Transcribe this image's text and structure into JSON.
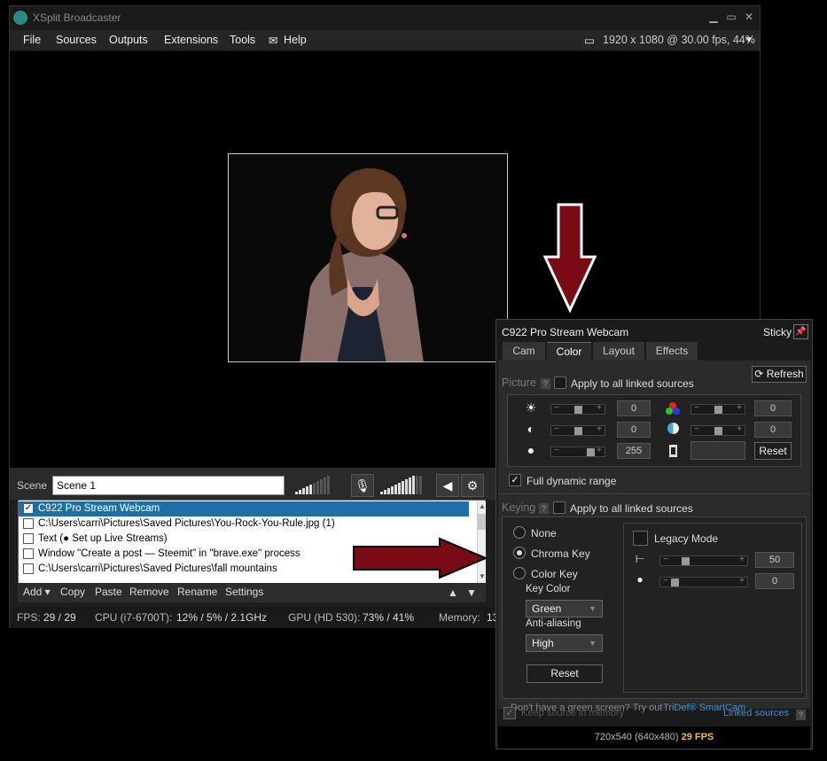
{
  "window": {
    "title": "XSplit Broadcaster",
    "controls": {
      "minimize": "▁",
      "maximize": "▭",
      "close": "✕"
    }
  },
  "menu": {
    "items": [
      "File",
      "Sources",
      "Outputs",
      "Extensions",
      "Tools",
      "Help"
    ],
    "resolution": "1920 x 1080 @ 30.00 fps, 44%"
  },
  "scene": {
    "label": "Scene",
    "name": "Scene 1"
  },
  "sources": {
    "items": [
      {
        "label": "C922 Pro Stream Webcam",
        "checked": true,
        "selected": true
      },
      {
        "label": "C:\\Users\\carri\\Pictures\\Saved Pictures\\You-Rock-You-Rule.jpg (1)",
        "checked": false
      },
      {
        "label": "Text (● Set up Live Streams)",
        "checked": false
      },
      {
        "label": "Window \"Create a post — Steemit\" in \"brave.exe\" process",
        "checked": false
      },
      {
        "label": "C:\\Users\\carri\\Pictures\\Saved Pictures\\fall mountains",
        "checked": false
      }
    ],
    "actions": [
      "Add ▾",
      "Copy",
      "Paste",
      "Remove",
      "Rename",
      "Settings"
    ]
  },
  "status": {
    "fps_label": "FPS:",
    "fps": "29 / 29",
    "cpu_label": "CPU (i7-6700T):",
    "cpu": "12% / 5% / 2.1GHz",
    "gpu_label": "GPU (HD 530):",
    "gpu": "73% / 41%",
    "memory_label": "Memory:",
    "memory": "13"
  },
  "panel": {
    "title": "C922 Pro Stream Webcam",
    "sticky": "Sticky",
    "tabs": [
      "Cam",
      "Color",
      "Layout",
      "Effects"
    ],
    "active_tab": "Color",
    "refresh": "Refresh",
    "picture": {
      "heading": "Picture",
      "apply_all": "Apply to all linked sources",
      "brightness": "0",
      "contrast": "0",
      "saturation": "255",
      "hue": "0",
      "color_balance": "0",
      "reset": "Reset",
      "full_range": "Full dynamic range"
    },
    "keying": {
      "heading": "Keying",
      "apply_all": "Apply to all linked sources",
      "options": [
        "None",
        "Chroma Key",
        "Color Key"
      ],
      "selected": "Chroma Key",
      "key_color_label": "Key Color",
      "key_color": "Green",
      "antialias_label": "Anti-aliasing",
      "antialias": "High",
      "reset": "Reset",
      "legacy": "Legacy Mode",
      "threshold": "50",
      "similarity": "0",
      "promo_text": "Don't have a green screen? Try out",
      "promo_link": "TriDef® SmartCam"
    },
    "keep_memory": "Keep source in memory",
    "linked_sources": "Linked sources",
    "footer_res": "720x540 (640x480)",
    "footer_fps": "29 FPS"
  },
  "colors": {
    "accent": "#1e6fa8",
    "arrow": "#7a0a14",
    "link": "#3a8ed8",
    "fps": "#f0c030"
  }
}
